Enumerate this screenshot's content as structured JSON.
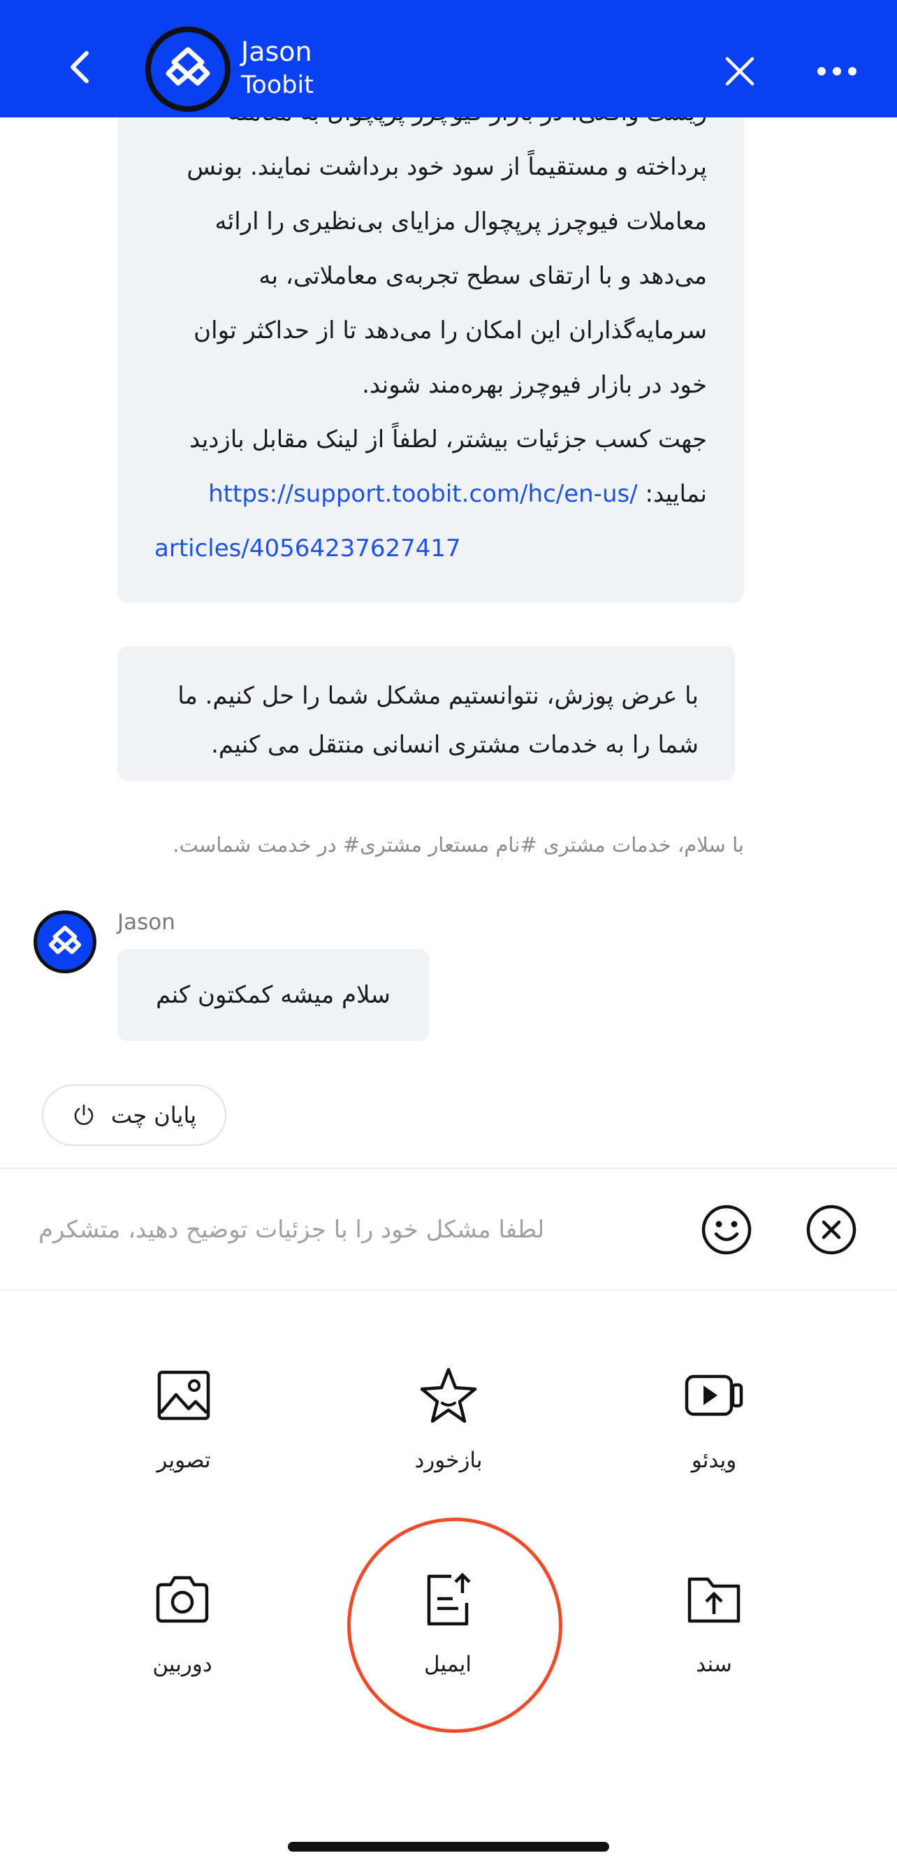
{
  "header": {
    "agent_name": "Jason",
    "agent_subtitle": "Toobit",
    "background_color": "#0a3ff2"
  },
  "messages": {
    "bot_message_1": {
      "lines": [
        "ریسک واقعی، در بازار فیوچرز پرپچوال به معامله",
        "پرداخته و مستقیماً از سود خود برداشت نمایند. بونس",
        "معاملات فیوچرز پرپچوال مزایای بی‌نظیری را ارائه",
        "می‌دهد و با ارتقای سطح تجربه‌ی معاملاتی، به",
        "سرمایه‌گذاران این امکان را می‌دهد تا از حداکثر توان",
        "خود در بازار فیوچرز بهره‌مند شوند.",
        "جهت کسب جزئیات بیشتر، لطفاً از لینک مقابل بازدید"
      ],
      "link_prefix": "نمایید:",
      "link_part_1": "https://support.toobit.com/hc/en-us/",
      "link_part_2": "articles/40564237627417"
    },
    "bot_message_2": {
      "line_1": "با عرض پوزش، نتوانستیم مشکل شما را حل کنیم. ما",
      "line_2": "شما را به خدمات مشتری انسانی منتقل می کنیم."
    },
    "system_message": "با سلام، خدمات مشتری #نام مستعار مشتری# در خدمت شماست.",
    "agent_message": {
      "sender": "Jason",
      "text": "سلام میشه کمکتون کنم"
    }
  },
  "end_chat_label": "پایان چت",
  "input": {
    "placeholder": "لطفا مشکل خود را با جزئیات توضیح دهید، متشکرم",
    "value": ""
  },
  "attachments": [
    {
      "label": "تصویر",
      "icon": "image-icon"
    },
    {
      "label": "بازخورد",
      "icon": "star-icon"
    },
    {
      "label": "ویدئو",
      "icon": "video-icon"
    },
    {
      "label": "دوربین",
      "icon": "camera-icon"
    },
    {
      "label": "ایمیل",
      "icon": "email-upload-icon"
    },
    {
      "label": "سند",
      "icon": "folder-upload-icon"
    }
  ],
  "highlight_color": "#ef4a2a"
}
